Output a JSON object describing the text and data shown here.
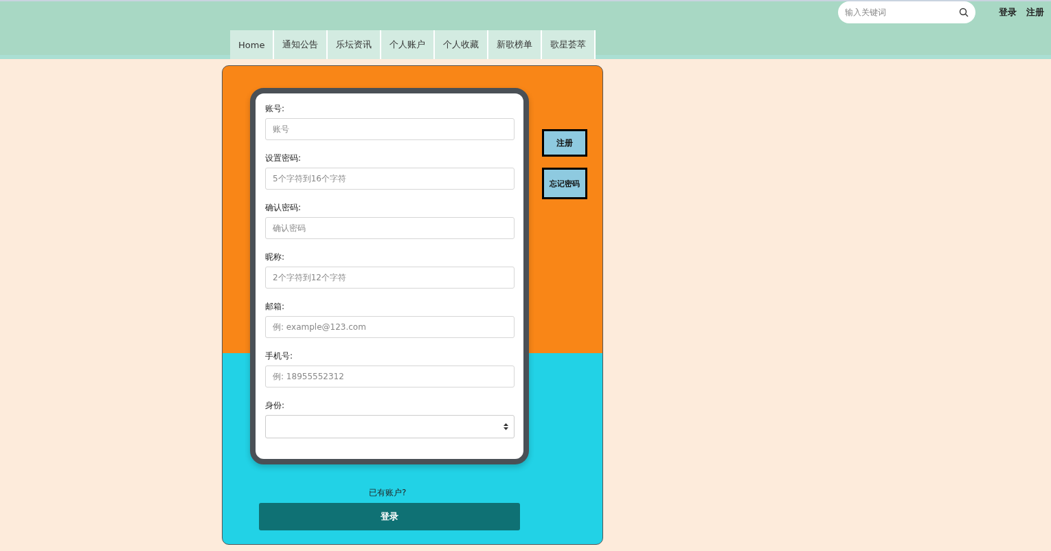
{
  "header": {
    "search": {
      "placeholder": "输入关键词"
    },
    "links": [
      "登录",
      "注册"
    ]
  },
  "nav": [
    {
      "label": "Home",
      "selected": false
    },
    {
      "label": "通知公告",
      "selected": false
    },
    {
      "label": "乐坛资讯",
      "selected": false
    },
    {
      "label": "个人账户",
      "selected": false
    },
    {
      "label": "个人收藏",
      "selected": false
    },
    {
      "label": "新歌榜单",
      "selected": false
    },
    {
      "label": "歌星荟萃",
      "selected": false
    }
  ],
  "form": {
    "fields": [
      {
        "kind": "input",
        "label": "账号:",
        "placeholder": "账号"
      },
      {
        "kind": "input",
        "label": "设置密码:",
        "placeholder": "5个字符到16个字符"
      },
      {
        "kind": "input",
        "label": "确认密码:",
        "placeholder": "确认密码"
      },
      {
        "kind": "input",
        "label": "昵称:",
        "placeholder": "2个字符到12个字符"
      },
      {
        "kind": "input",
        "label": "邮箱:",
        "placeholder": "例: example@123.com"
      },
      {
        "kind": "input",
        "label": "手机号:",
        "placeholder": "例: 18955552312"
      },
      {
        "kind": "select",
        "label": "身份:"
      }
    ],
    "side_buttons": [
      "注册",
      "忘记密码"
    ],
    "prompt": "已有账户?",
    "login_button": "登录"
  }
}
